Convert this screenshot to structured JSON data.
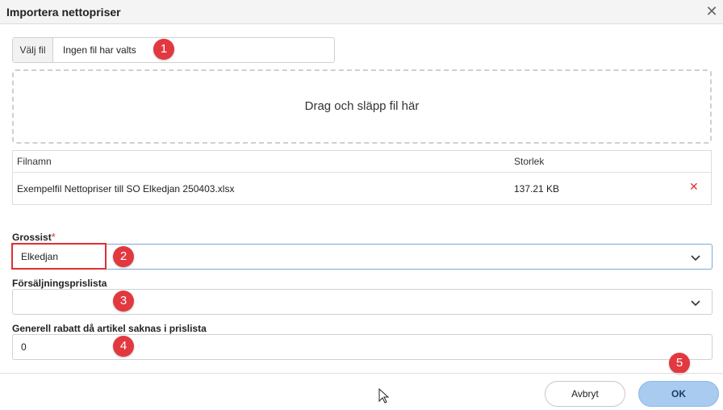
{
  "dialog": {
    "title": "Importera nettopriser",
    "close_icon": "close-icon"
  },
  "file_picker": {
    "button_label": "Välj fil",
    "selected_file": "Ingen fil har valts"
  },
  "dropzone": {
    "text": "Drag och släpp fil här"
  },
  "file_table": {
    "headers": [
      "Filnamn",
      "Storlek"
    ],
    "rows": [
      {
        "name": "Exempelfil Nettopriser till SO Elkedjan 250403.xlsx",
        "size": "137.21 KB",
        "remove_icon": "remove-icon"
      }
    ]
  },
  "form": {
    "grossist": {
      "label": "Grossist",
      "required_mark": "*",
      "value": "Elkedjan"
    },
    "forsaljningsprislista": {
      "label": "Försäljningsprislista",
      "value": ""
    },
    "rabatt": {
      "label": "Generell rabatt då artikel saknas i prislista",
      "value": "0"
    }
  },
  "footer": {
    "cancel_label": "Avbryt",
    "ok_label": "OK"
  },
  "annotations": {
    "markers": [
      "1",
      "2",
      "3",
      "4",
      "5"
    ],
    "color": "#e2383f"
  },
  "colors": {
    "ok_button": "#a9cbf0",
    "required": "#d33333",
    "focus_border": "#7fa6d8"
  }
}
